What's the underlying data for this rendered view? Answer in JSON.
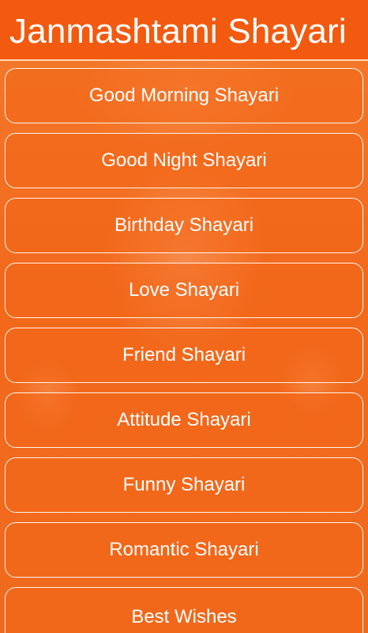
{
  "header": {
    "title": "Janmashtami Shayari"
  },
  "colors": {
    "background": "#f26a1c",
    "header": "#f25a0f",
    "button_border": "#fff3ea",
    "text": "#ffffff"
  },
  "menu": {
    "items": [
      {
        "label": "Good Morning Shayari"
      },
      {
        "label": "Good Night Shayari"
      },
      {
        "label": "Birthday Shayari"
      },
      {
        "label": "Love Shayari"
      },
      {
        "label": "Friend Shayari"
      },
      {
        "label": "Attitude Shayari"
      },
      {
        "label": "Funny Shayari"
      },
      {
        "label": "Romantic Shayari"
      },
      {
        "label": "Best Wishes"
      }
    ]
  }
}
